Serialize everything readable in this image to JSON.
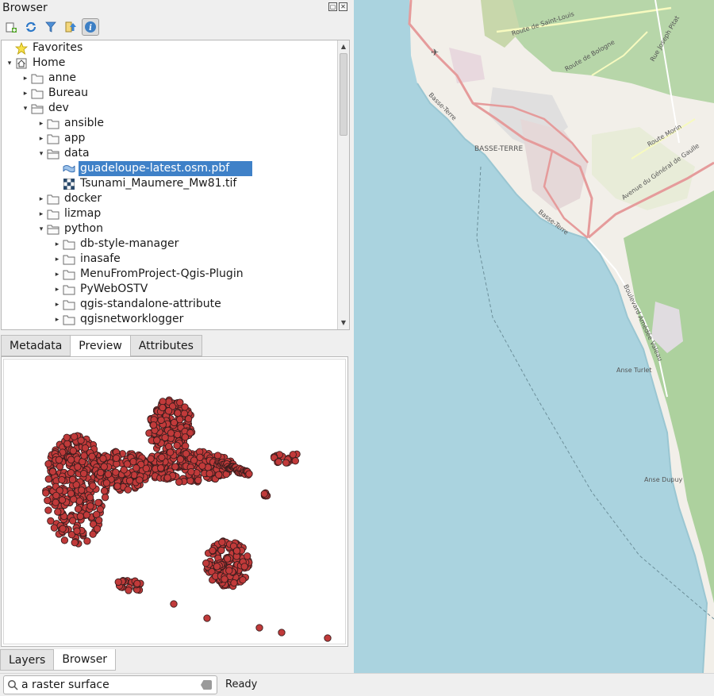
{
  "browser": {
    "title": "Browser",
    "toolbar": [
      {
        "name": "add-layer-icon"
      },
      {
        "name": "refresh-icon"
      },
      {
        "name": "filter-icon"
      },
      {
        "name": "collapse-all-icon"
      },
      {
        "name": "properties-icon"
      }
    ],
    "tree": [
      {
        "label": "Favorites",
        "depth": 0,
        "icon": "star-icon",
        "arrow": "none"
      },
      {
        "label": "Home",
        "depth": 0,
        "icon": "home-icon",
        "arrow": "open"
      },
      {
        "label": "anne",
        "depth": 1,
        "icon": "folder-icon",
        "arrow": "closed"
      },
      {
        "label": "Bureau",
        "depth": 1,
        "icon": "folder-icon",
        "arrow": "closed"
      },
      {
        "label": "dev",
        "depth": 1,
        "icon": "folder-open-icon",
        "arrow": "open"
      },
      {
        "label": "ansible",
        "depth": 2,
        "icon": "folder-icon",
        "arrow": "closed"
      },
      {
        "label": "app",
        "depth": 2,
        "icon": "folder-icon",
        "arrow": "closed"
      },
      {
        "label": "data",
        "depth": 2,
        "icon": "folder-open-icon",
        "arrow": "open"
      },
      {
        "label": "guadeloupe-latest.osm.pbf",
        "depth": 3,
        "icon": "vector-file-icon",
        "arrow": "none",
        "selected": true
      },
      {
        "label": "Tsunami_Maumere_Mw81.tif",
        "depth": 3,
        "icon": "raster-file-icon",
        "arrow": "none"
      },
      {
        "label": "docker",
        "depth": 2,
        "icon": "folder-icon",
        "arrow": "closed"
      },
      {
        "label": "lizmap",
        "depth": 2,
        "icon": "folder-icon",
        "arrow": "closed"
      },
      {
        "label": "python",
        "depth": 2,
        "icon": "folder-open-icon",
        "arrow": "open"
      },
      {
        "label": "db-style-manager",
        "depth": 3,
        "icon": "folder-icon",
        "arrow": "closed"
      },
      {
        "label": "inasafe",
        "depth": 3,
        "icon": "folder-icon",
        "arrow": "closed"
      },
      {
        "label": "MenuFromProject-Qgis-Plugin",
        "depth": 3,
        "icon": "folder-icon",
        "arrow": "closed"
      },
      {
        "label": "PyWebOSTV",
        "depth": 3,
        "icon": "folder-icon",
        "arrow": "closed"
      },
      {
        "label": "qgis-standalone-attribute",
        "depth": 3,
        "icon": "folder-icon",
        "arrow": "closed"
      },
      {
        "label": "qgisnetworklogger",
        "depth": 3,
        "icon": "folder-icon",
        "arrow": "closed"
      }
    ],
    "panel_tabs": [
      {
        "label": "Metadata",
        "active": false
      },
      {
        "label": "Preview",
        "active": true
      },
      {
        "label": "Attributes",
        "active": false
      }
    ]
  },
  "bottom_tabs": [
    {
      "label": "Layers",
      "active": false
    },
    {
      "label": "Browser",
      "active": true
    }
  ],
  "status": {
    "search_value": "a raster surface",
    "message": "Ready"
  },
  "map": {
    "labels": [
      {
        "text": "BASSE-TERRE"
      },
      {
        "text": "Route de Saint-Louis"
      },
      {
        "text": "Route de Bologne"
      },
      {
        "text": "Rue Joseph Pitat"
      },
      {
        "text": "Basse-Terre"
      },
      {
        "text": "Route Morin"
      },
      {
        "text": "Avenue du Général de Gaulle"
      },
      {
        "text": "Boulevard Amédée Valeau"
      },
      {
        "text": "Anse Turlet"
      },
      {
        "text": "Anse Dupuy"
      },
      {
        "text": "Basse-Terre"
      }
    ],
    "colors": {
      "sea": "#aad3df",
      "land": "#f2efe9",
      "forest": "#add19e",
      "road": "#e59b9b"
    }
  },
  "preview_colors": {
    "point_fill": "#c13a3a",
    "point_stroke": "#3a1d1d"
  }
}
